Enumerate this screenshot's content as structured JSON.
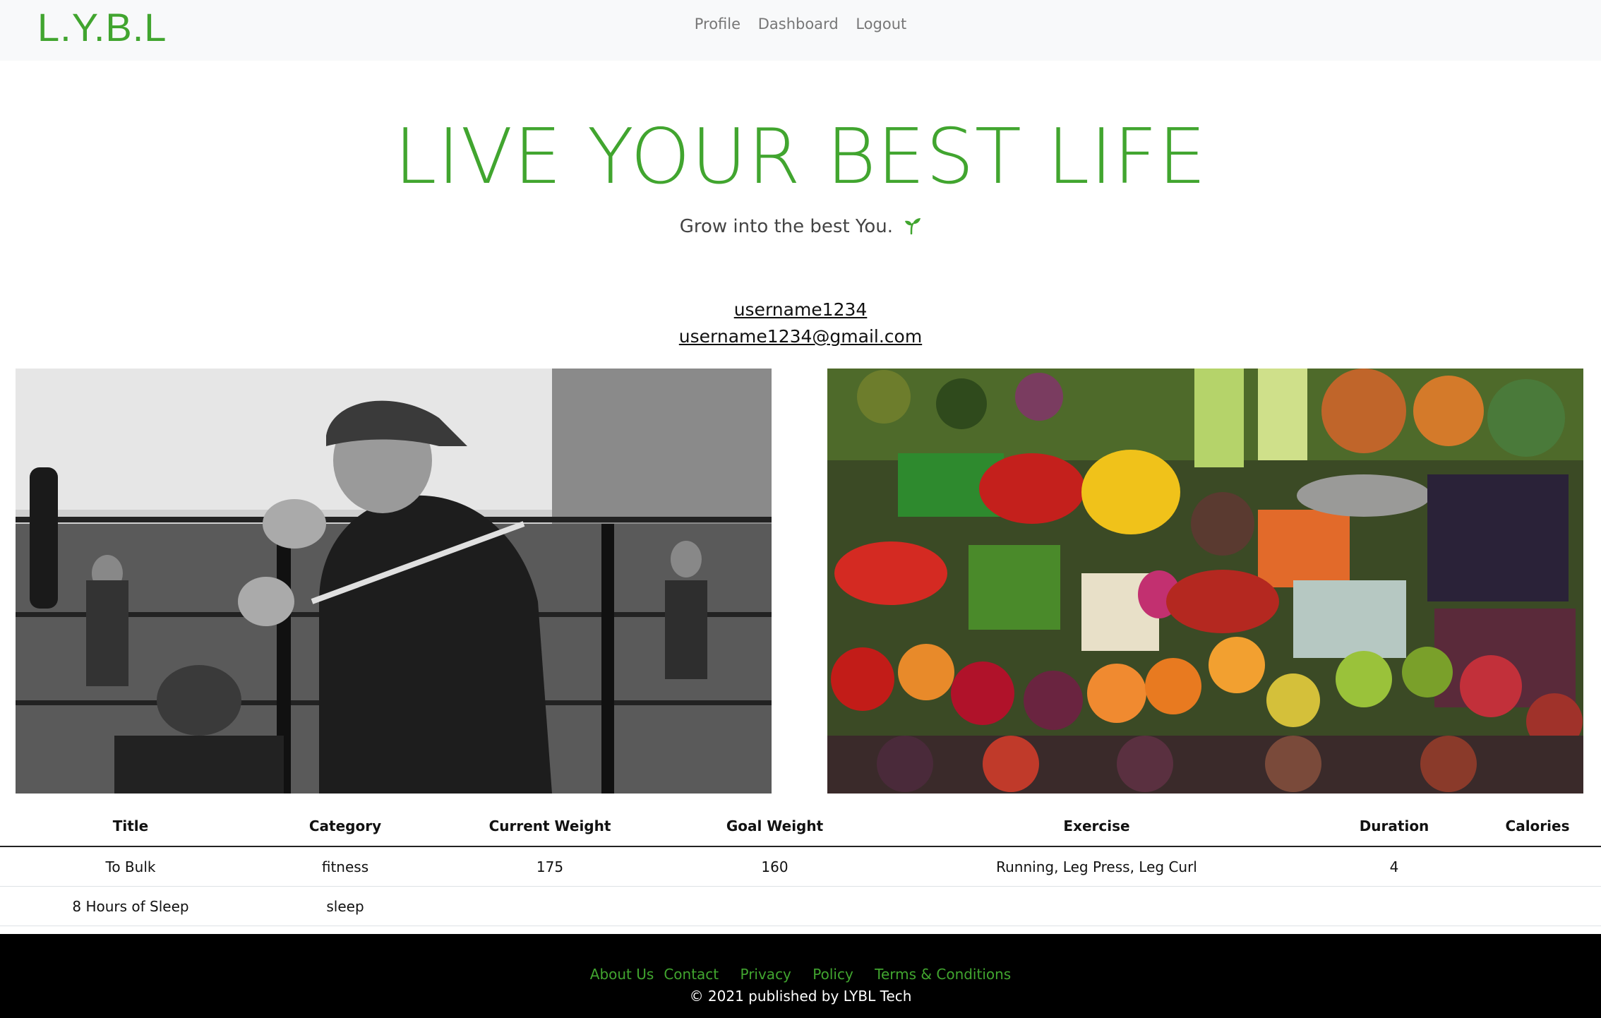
{
  "navbar": {
    "brand": "L.Y.B.L",
    "links": [
      "Profile",
      "Dashboard",
      "Logout"
    ]
  },
  "hero": {
    "title": "LIVE YOUR BEST LIFE",
    "subtitle": "Grow into the best You.",
    "subtitle_icon": "sprout-icon"
  },
  "user": {
    "username": "username1234",
    "email": "username1234@gmail.com"
  },
  "photos": {
    "left": "boxing-gym-photo",
    "right": "produce-market-photo"
  },
  "table": {
    "headers": [
      "Title",
      "Category",
      "Current Weight",
      "Goal Weight",
      "Exercise",
      "Duration",
      "Calories"
    ],
    "rows": [
      [
        "To Bulk",
        "fitness",
        "175",
        "160",
        "Running, Leg Press, Leg Curl",
        "4",
        ""
      ],
      [
        "8 Hours of Sleep",
        "sleep",
        "",
        "",
        "",
        "",
        ""
      ]
    ]
  },
  "footer": {
    "links": [
      "About Us",
      "Contact",
      "Privacy",
      "Policy",
      "Terms & Conditions"
    ],
    "copyright": "© 2021 published by LYBL Tech"
  },
  "colors": {
    "accent": "#41a52f",
    "navbar_bg": "#f8f9fa",
    "footer_bg": "#000000"
  }
}
